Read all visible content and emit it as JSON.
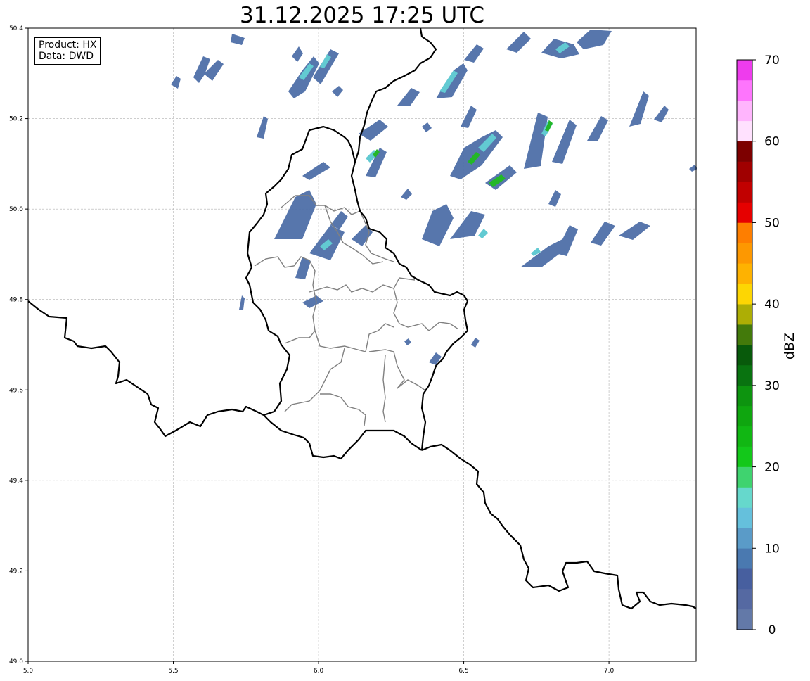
{
  "title": "31.12.2025 17:25 UTC",
  "info": {
    "product": "Product: HX",
    "source": "Data: DWD"
  },
  "map": {
    "lon_range": [
      5.0,
      7.3
    ],
    "lat_range": [
      49.0,
      50.4
    ],
    "x_ticks": [
      "5.0",
      "5.5",
      "6.0",
      "6.5",
      "7.0"
    ],
    "y_ticks": [
      "49.0",
      "49.2",
      "49.4",
      "49.6",
      "49.8",
      "50.0",
      "50.2",
      "50.4"
    ],
    "grid": true,
    "border_color": "#000000",
    "district_color": "#808080",
    "gridline_color": "#b0b0b0"
  },
  "colorbar": {
    "label": "dBZ",
    "min": 0,
    "max": 70,
    "step": 2.5,
    "tick_labels": [
      "0",
      "10",
      "20",
      "30",
      "40",
      "50",
      "60",
      "70"
    ],
    "colors": [
      "#6379a8",
      "#5569a2",
      "#475f9f",
      "#4a79b0",
      "#5a9bc8",
      "#65c0dc",
      "#66d8cc",
      "#3fd36f",
      "#13c81a",
      "#11b713",
      "#0fa60f",
      "#0d940f",
      "#097310",
      "#085a0b",
      "#437a0b",
      "#adae05",
      "#fdd603",
      "#feb201",
      "#fd9801",
      "#fe7e00",
      "#e60000",
      "#c10000",
      "#a00000",
      "#7d0000",
      "#ffe1fe",
      "#ffb5fd",
      "#fe75fd",
      "#ee3ced"
    ]
  }
}
